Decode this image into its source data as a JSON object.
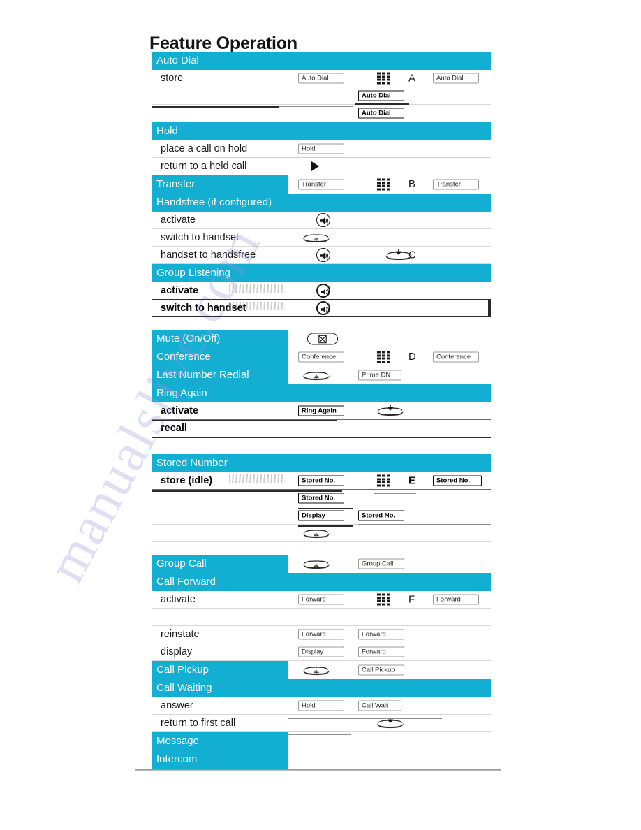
{
  "document": {
    "title": "Feature Operation",
    "watermark": "manualslive.com",
    "accent_color": "#12AFD3",
    "band_text_color": "#FFFFFF",
    "page_background": "#FFFFFF"
  },
  "icons": {
    "keypad": "keypad-icon",
    "handsfree": "speaker-icon",
    "handset": "handset-icon",
    "mute": "mute-crossed-icon",
    "play": "play-triangle-icon"
  },
  "sections": [
    {
      "id": "auto-dial",
      "band": "Auto Dial",
      "band_partial": false,
      "rows": [
        {
          "label": "store",
          "label_bold": false,
          "chips": [
            {
              "text": "Auto Dial",
              "col": "cA",
              "width": "w66",
              "style": "light"
            },
            {
              "text": "Auto Dial",
              "col": "cC",
              "width": "w66",
              "style": "light"
            }
          ],
          "keypad": true,
          "letter": "A"
        },
        {
          "label": "",
          "chips": [
            {
              "text": "Auto Dial",
              "col": "cB",
              "width": "w66",
              "style": "dark"
            }
          ]
        },
        {
          "label": "",
          "chips": [
            {
              "text": "Auto Dial",
              "col": "cB",
              "width": "w66",
              "style": "dark"
            }
          ]
        }
      ]
    },
    {
      "id": "hold",
      "band": "Hold",
      "band_partial": false,
      "rows": [
        {
          "label": "place a call on hold",
          "chips": [
            {
              "text": "Hold",
              "col": "cA",
              "width": "w66",
              "style": "light"
            }
          ]
        },
        {
          "label": "return to a held call",
          "chips": [],
          "triangle": true
        }
      ]
    },
    {
      "id": "transfer",
      "band": "Transfer",
      "band_partial": true,
      "inline": {
        "chips": [
          {
            "text": "Transfer",
            "col": "cA",
            "width": "w66",
            "style": "light"
          },
          {
            "text": "Transfer",
            "col": "cC",
            "width": "w66",
            "style": "light"
          }
        ],
        "keypad": true,
        "letter": "B"
      },
      "rows": []
    },
    {
      "id": "handsfree",
      "band": "Handsfree (if configured)",
      "band_partial": false,
      "rows": [
        {
          "label": "activate",
          "speaker": true
        },
        {
          "label": "switch to handset",
          "handset": true
        },
        {
          "label": "handset to handsfree",
          "speaker": true,
          "handset2": true,
          "letter": "C"
        }
      ]
    },
    {
      "id": "group-listening",
      "band": "Group Listening",
      "band_partial": false,
      "rows": [
        {
          "label": "activate",
          "label_bold": true,
          "speaker_bold": true,
          "smudge": true
        },
        {
          "label": "switch to handset",
          "label_bold": true,
          "speaker_bold": true,
          "smudge": true
        }
      ]
    },
    {
      "id": "mute",
      "band": "Mute (On/Off)",
      "band_partial": true,
      "inline": {
        "mute": true
      },
      "rows": []
    },
    {
      "id": "conference",
      "band": "Conference",
      "band_partial": true,
      "inline": {
        "chips": [
          {
            "text": "Conference",
            "col": "cA",
            "width": "w66",
            "style": "light"
          },
          {
            "text": "Conference",
            "col": "cC",
            "width": "w66",
            "style": "light"
          }
        ],
        "keypad": true,
        "letter": "D"
      },
      "rows": []
    },
    {
      "id": "last-number-redial",
      "band": "Last Number Redial",
      "band_partial": true,
      "inline": {
        "handset": true,
        "chips": [
          {
            "text": "Prime DN",
            "col": "cB",
            "width": "w62",
            "style": "light"
          }
        ]
      },
      "rows": []
    },
    {
      "id": "ring-again",
      "band": "Ring Again",
      "band_partial": false,
      "rows": [
        {
          "label": "activate",
          "label_bold": true,
          "chips": [
            {
              "text": "Ring Again",
              "col": "cA",
              "width": "w66",
              "style": "dark"
            }
          ],
          "handset2": true
        },
        {
          "label": "recall",
          "label_bold": true
        }
      ]
    },
    {
      "id": "stored-number",
      "band": "Stored Number",
      "band_partial": false,
      "rows": [
        {
          "label": "store (idle)",
          "label_bold": true,
          "smudge": true,
          "chips": [
            {
              "text": "Stored No.",
              "col": "cA",
              "width": "w66",
              "style": "dark"
            },
            {
              "text": "Stored No.",
              "col": "cC",
              "width": "w70",
              "style": "dark"
            }
          ],
          "keypad": true,
          "letter": "E",
          "letter_bold": true
        },
        {
          "label": "",
          "chips": [
            {
              "text": "Stored No.",
              "col": "cA",
              "width": "w66",
              "style": "dark"
            }
          ]
        },
        {
          "label": "",
          "chips": [
            {
              "text": "Display",
              "col": "cA",
              "width": "w66",
              "style": "dark"
            },
            {
              "text": "Stored No.",
              "col": "cB",
              "width": "w66",
              "style": "dark"
            }
          ]
        },
        {
          "label": "",
          "handset": true
        }
      ]
    },
    {
      "id": "group-call",
      "band": "Group Call",
      "band_partial": true,
      "inline": {
        "handset": true,
        "chips": [
          {
            "text": "Group Call",
            "col": "cB",
            "width": "w66",
            "style": "light"
          }
        ]
      },
      "rows": []
    },
    {
      "id": "call-forward",
      "band": "Call Forward",
      "band_partial": false,
      "rows": [
        {
          "label": "activate",
          "chips": [
            {
              "text": "Forward",
              "col": "cA",
              "width": "w66",
              "style": "light"
            },
            {
              "text": "Forward",
              "col": "cC",
              "width": "w66",
              "style": "light"
            }
          ],
          "keypad": true,
          "letter": "F"
        },
        {
          "label": ""
        },
        {
          "label": "reinstate",
          "chips": [
            {
              "text": "Forward",
              "col": "cA",
              "width": "w66",
              "style": "light"
            },
            {
              "text": "Forward",
              "col": "cB",
              "width": "w66",
              "style": "light"
            }
          ]
        },
        {
          "label": "display",
          "chips": [
            {
              "text": "Display",
              "col": "cA",
              "width": "w66",
              "style": "light"
            },
            {
              "text": "Forward",
              "col": "cB",
              "width": "w66",
              "style": "light"
            }
          ]
        }
      ]
    },
    {
      "id": "call-pickup",
      "band": "Call Pickup",
      "band_partial": true,
      "inline": {
        "handset": true,
        "chips": [
          {
            "text": "Call Pickup",
            "col": "cB",
            "width": "w66",
            "style": "light"
          }
        ]
      },
      "rows": []
    },
    {
      "id": "call-waiting",
      "band": "Call Waiting",
      "band_partial": false,
      "rows": [
        {
          "label": "answer",
          "chips": [
            {
              "text": "Hold",
              "col": "cA",
              "width": "w66",
              "style": "light"
            },
            {
              "text": "Call Wait",
              "col": "cB",
              "width": "w62",
              "style": "light"
            }
          ]
        },
        {
          "label": "return to first call",
          "handset2": true
        }
      ]
    },
    {
      "id": "message",
      "band": "Message",
      "band_partial": true,
      "inline": {},
      "rows": []
    },
    {
      "id": "intercom",
      "band": "Intercom",
      "band_partial": true,
      "inline": {},
      "rows": []
    }
  ]
}
